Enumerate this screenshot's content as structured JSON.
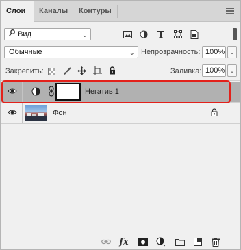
{
  "tabs": [
    {
      "label": "Слои"
    },
    {
      "label": "Каналы"
    },
    {
      "label": "Контуры"
    }
  ],
  "filter": {
    "value": "Вид"
  },
  "blend_mode": {
    "value": "Обычные"
  },
  "opacity": {
    "label": "Непрозрачность:",
    "value": "100%"
  },
  "lock": {
    "label": "Закрепить:"
  },
  "fill": {
    "label": "Заливка:",
    "value": "100%"
  },
  "layers": [
    {
      "name": "Негатив 1",
      "selected": true
    },
    {
      "name": "Фон",
      "locked": true
    }
  ],
  "footer": {
    "fx_label": "fx"
  },
  "colors": {
    "accent": "#e3211b",
    "selected_row": "#b1b1b1"
  }
}
